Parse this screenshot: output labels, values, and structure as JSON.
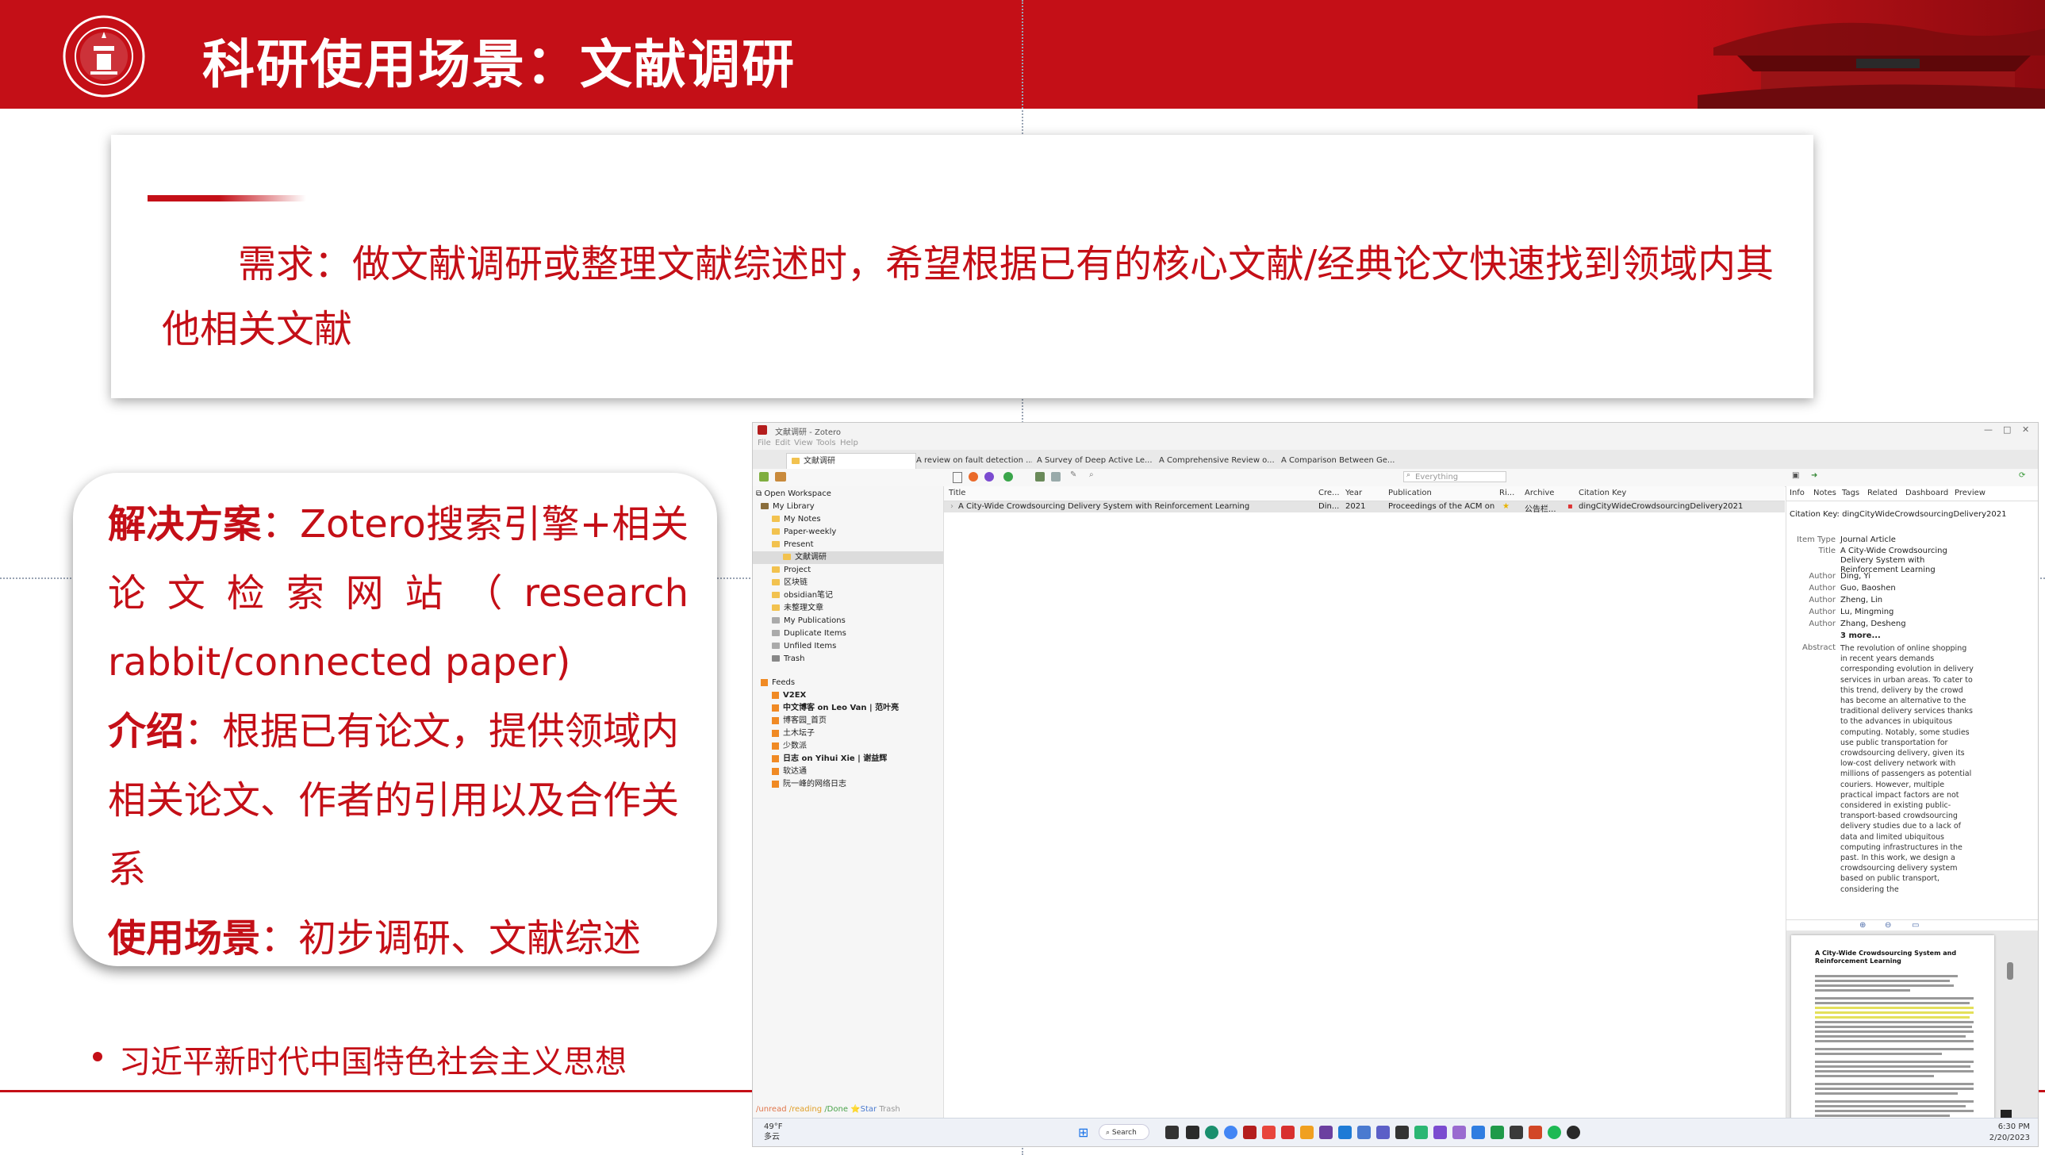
{
  "slide": {
    "title": "科研使用场景：文献调研",
    "need_text": "需求：做文献调研或整理文献综述时，希望根据已有的核心文献/经典论文快速找到领域内其他相关文献",
    "solution": {
      "label": "解决方案",
      "colon": "：",
      "text": "Zotero搜索引擎+相关论文检索网站（research rabbit/connected paper)"
    },
    "intro": {
      "label": "介绍",
      "colon": "：",
      "text": "根据已有论文，提供领域内相关论文、作者的引用以及合作关系"
    },
    "usage": {
      "label": "使用场景",
      "colon": "：",
      "text": "初步调研、文献综述"
    },
    "bullet": "习近平新时代中国特色社会主义思想",
    "colors": {
      "brand_red": "#c40f17",
      "white": "#ffffff"
    }
  },
  "zotero": {
    "window_title": "文献调研 - Zotero",
    "menu": [
      "File",
      "Edit",
      "View",
      "Tools",
      "Help"
    ],
    "tabs": [
      "文献调研",
      "A review on fault detection ...",
      "A Survey of Deep Active Le...",
      "A Comprehensive Review o...",
      "A Comparison Between Ge..."
    ],
    "search_placeholder": "Everything",
    "tree": [
      "Open Workspace",
      "My Library",
      "My Notes",
      "Paper-weekly",
      "Present",
      "文献调研",
      "Project",
      "区块链",
      "obsidian笔记",
      "未整理文章",
      "My Publications",
      "Duplicate Items",
      "Unfiled Items",
      "Trash"
    ],
    "feeds_label": "Feeds",
    "feeds": [
      "V2EX",
      "中文博客 on Leo Van | 范叶亮",
      "博客园_首页",
      "土木坛子",
      "少数派",
      "日志 on Yihui Xie | 谢益辉",
      "软达通",
      "阮一峰的网络日志"
    ],
    "tags_line": [
      "/unread",
      "/reading",
      "/Done",
      "⭐Star",
      "Trash"
    ],
    "columns": [
      "Title",
      "Cre...",
      "Year",
      "Publication",
      "Ri...",
      "Archive",
      "Citation Key"
    ],
    "row": {
      "title": "A City-Wide Crowdsourcing Delivery System with Reinforcement Learning",
      "creator": "Din...",
      "year": "2021",
      "publication": "Proceedings of the ACM on Interactiv...",
      "archive": "公告栏...",
      "citation_key": "dingCityWideCrowdsourcingDelivery2021"
    },
    "right_tabs": [
      "Info",
      "Notes",
      "Tags",
      "Related",
      "Dashboard",
      "Preview"
    ],
    "citation_key_line": "Citation Key: dingCityWideCrowdsourcingDelivery2021",
    "item_type_label": "Item Type",
    "item_type": "Journal Article",
    "title_label": "Title",
    "item_title": "A City-Wide Crowdsourcing Delivery System with Reinforcement Learning",
    "author_label": "Author",
    "authors": [
      "Ding, Yi",
      "Guo, Baoshen",
      "Zheng, Lin",
      "Lu, Mingming",
      "Zhang, Desheng"
    ],
    "more_authors": "3 more...",
    "abstract_label": "Abstract",
    "abstract": "The revolution of online shopping in recent years demands corresponding evolution in delivery services in urban areas. To cater to this trend, delivery by the crowd has become an alternative to the traditional delivery services thanks to the advances in ubiquitous computing. Notably, some studies use public transportation for crowdsourcing delivery, given its low-cost delivery network with millions of passengers as potential couriers. However, multiple practical impact factors are not considered in existing public-transport-based crowdsourcing delivery studies due to a lack of data and limited ubiquitous computing infrastructures in the past. In this work, we design a crowdsourcing delivery system based on public transport, considering the",
    "pdf_heading": "A City-Wide Crowdsourcing System and Reinforcement Learning",
    "taskbar": {
      "weather_temp": "49°F",
      "weather_desc": "多云",
      "search_label": "Search",
      "time": "6:30 PM",
      "date": "2/20/2023"
    }
  }
}
